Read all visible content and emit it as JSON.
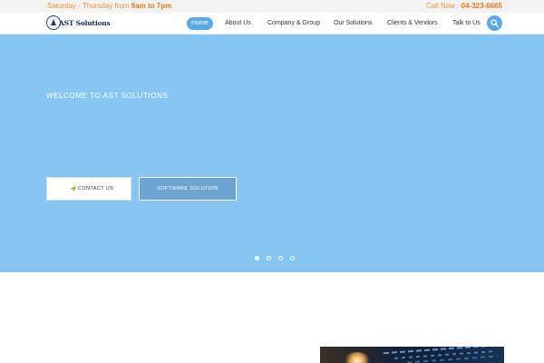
{
  "topbar": {
    "hours_prefix": "Saturday - Thursday from ",
    "hours_time": "9am to 7pm",
    "call_prefix": "Call Now : ",
    "call_number": "04-323-6665"
  },
  "header": {
    "logo_text": "AST Solutions",
    "nav": [
      {
        "label": "Home",
        "active": true
      },
      {
        "label": "About Us"
      },
      {
        "label": "Company & Group"
      },
      {
        "label": "Our Solutions"
      },
      {
        "label": "Clients & Vendors"
      },
      {
        "label": "Talk to Us"
      }
    ],
    "search_icon": "search-icon"
  },
  "hero": {
    "welcome": "WELCOME TO AST SOLUTIONS",
    "contact_label": "CONTACT US",
    "contact_icon": "paper-plane-icon",
    "software_label": "SOFTWARE SOLUTION",
    "slides": 4,
    "active_slide": 1,
    "background_color": "#87c5f3"
  },
  "colors": {
    "accent": "#5aa9e6",
    "topbar_text": "#e8923a"
  }
}
